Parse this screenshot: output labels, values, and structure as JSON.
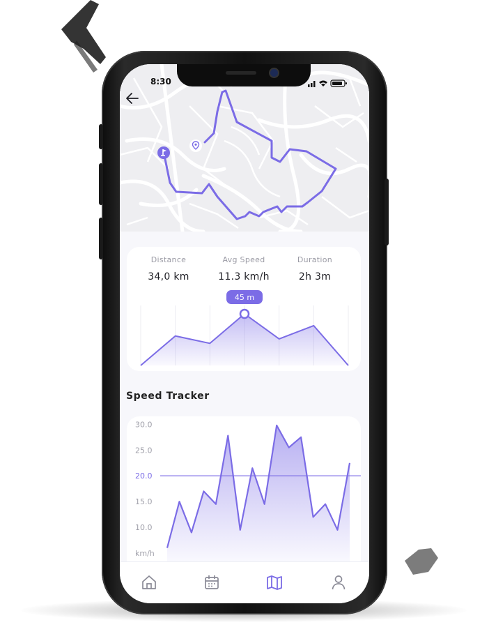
{
  "status_bar": {
    "time": "8:30"
  },
  "stats": [
    {
      "label": "Distance",
      "value": "34,0 km"
    },
    {
      "label": "Avg Speed",
      "value": "11.3 km/h"
    },
    {
      "label": "Duration",
      "value": "2h 3m"
    }
  ],
  "elevation_chart": {
    "tooltip": "45 m",
    "values": [
      0,
      20,
      15,
      35,
      18,
      27,
      0
    ],
    "highlight_index": 3,
    "color": "#7b6ce6"
  },
  "speed_tracker": {
    "title": "Speed Tracker"
  },
  "chart_data": {
    "type": "area",
    "y_tick_labels": [
      "30.0",
      "25.0",
      "20.0",
      "15.0",
      "10.0"
    ],
    "y_unit_label": "km/h",
    "ylim": [
      5,
      31
    ],
    "reference_line": 20.0,
    "values": [
      6,
      15,
      9,
      17,
      14.5,
      27.8,
      9.5,
      21.5,
      14.5,
      29.8,
      25.5,
      27.5,
      12,
      14.5,
      9.5,
      22.5
    ],
    "color": "#7b6ce6"
  },
  "nav": [
    {
      "icon": "home-icon",
      "active": false
    },
    {
      "icon": "calendar-icon",
      "active": false
    },
    {
      "icon": "map-icon",
      "active": true
    },
    {
      "icon": "profile-icon",
      "active": false
    }
  ],
  "colors": {
    "accent": "#7b6ce6",
    "inactive": "#8a8a96"
  }
}
